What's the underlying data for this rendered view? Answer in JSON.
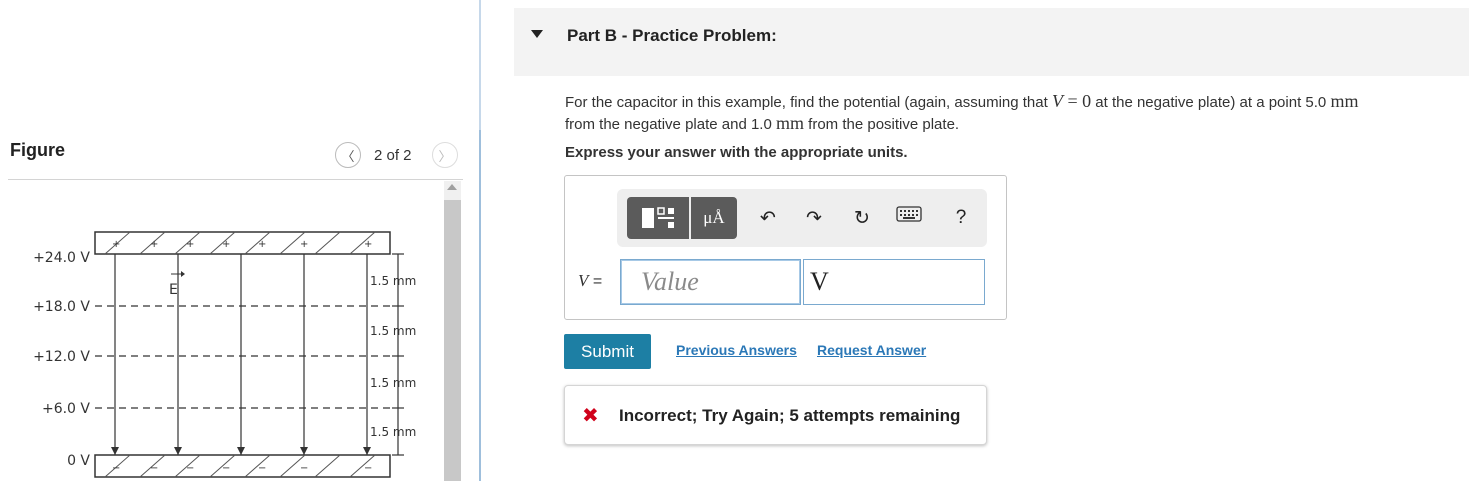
{
  "figure": {
    "title": "Figure",
    "page_indicator": "2 of 2",
    "prev_icon": "chevron-left-icon",
    "next_icon": "chevron-right-icon",
    "voltage_labels": [
      "+24.0 V",
      "+18.0 V",
      "+12.0 V",
      "+6.0 V",
      "0 V"
    ],
    "spacing_labels": [
      "1.5 mm",
      "1.5 mm",
      "1.5 mm",
      "1.5 mm"
    ],
    "field_label": "E"
  },
  "part_b": {
    "title": "Part B - Practice Problem:",
    "problem": {
      "text_1": "For the capacitor in this example, find the potential (again, assuming that ",
      "math_var": "V",
      "math_eq": " = 0",
      "text_2": " at the negative plate) at a point 5.0 ",
      "unit_1": "mm",
      "text_3": "from the negative plate and 1.0 ",
      "unit_2": "mm",
      "text_4": " from the positive plate."
    },
    "instruction": "Express your answer with the appropriate units.",
    "toolbar": {
      "units_label": "μÅ",
      "help_label": "?",
      "icons": [
        "templates-icon",
        "units-icon",
        "undo-icon",
        "redo-icon",
        "reset-icon",
        "keyboard-icon",
        "help-icon"
      ]
    },
    "answer": {
      "variable_label": "V =",
      "value_placeholder": "Value",
      "value": "",
      "unit_value": "V"
    },
    "submit_label": "Submit",
    "previous_answers_label": "Previous Answers",
    "request_answer_label": "Request Answer",
    "feedback": {
      "icon": "x-icon",
      "text": "Incorrect; Try Again; 5 attempts remaining"
    }
  },
  "colors": {
    "submit": "#1d7fa4",
    "link": "#2b78b7",
    "error": "#d0021b",
    "toolbar_button": "#5b5b5b"
  }
}
